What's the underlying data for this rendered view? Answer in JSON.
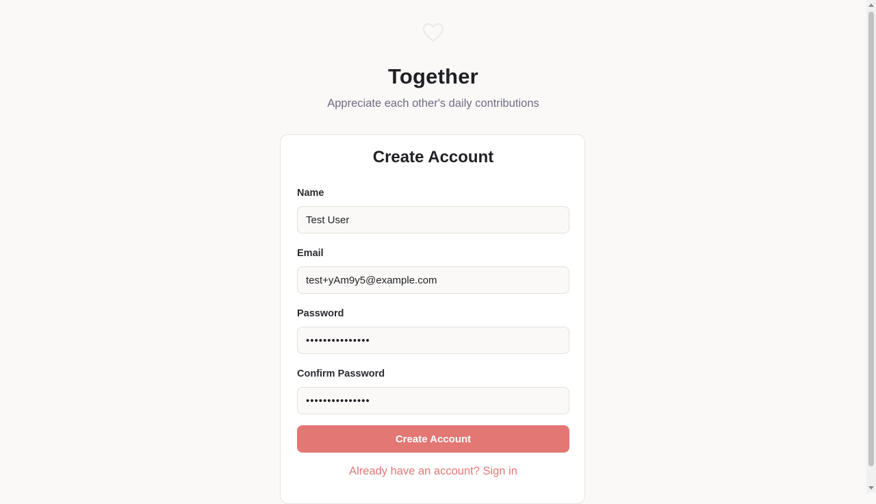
{
  "app": {
    "logo_icon": "heart-icon",
    "title": "Together",
    "subtitle": "Appreciate each other's daily contributions"
  },
  "form": {
    "title": "Create Account",
    "name": {
      "label": "Name",
      "value": "Test User"
    },
    "email": {
      "label": "Email",
      "value": "test+yAm9y5@example.com"
    },
    "password": {
      "label": "Password",
      "value": "password1234567"
    },
    "confirm_password": {
      "label": "Confirm Password",
      "value": "password1234567"
    },
    "submit_label": "Create Account",
    "signin_link": "Already have an account? Sign in"
  },
  "colors": {
    "accent": "#e37774",
    "background": "#faf9f7",
    "subtitle": "#6f6b86"
  }
}
